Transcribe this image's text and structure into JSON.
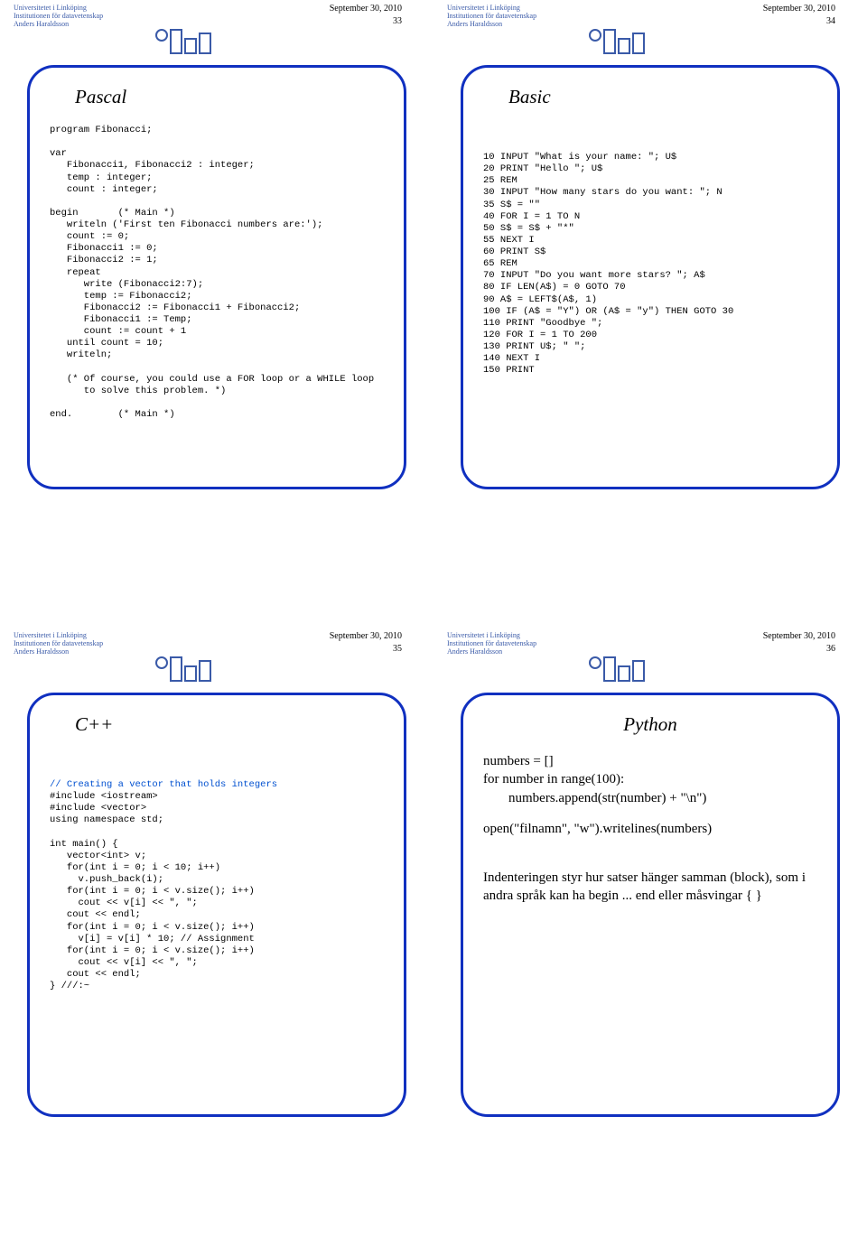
{
  "header": {
    "org1": "Universitetet i Linköping",
    "org2": "Institutionen för datavetenskap",
    "author": "Anders Haraldsson",
    "date": "September 30, 2010"
  },
  "slides": [
    {
      "num": "33",
      "title": "Pascal",
      "code": "program Fibonacci;\n\nvar\n   Fibonacci1, Fibonacci2 : integer;\n   temp : integer;\n   count : integer;\n\nbegin       (* Main *)\n   writeln ('First ten Fibonacci numbers are:');\n   count := 0;\n   Fibonacci1 := 0;\n   Fibonacci2 := 1;\n   repeat\n      write (Fibonacci2:7);\n      temp := Fibonacci2;\n      Fibonacci2 := Fibonacci1 + Fibonacci2;\n      Fibonacci1 := Temp;\n      count := count + 1\n   until count = 10;\n   writeln;\n\n   (* Of course, you could use a FOR loop or a WHILE loop\n      to solve this problem. *)\n\nend.        (* Main *)"
    },
    {
      "num": "34",
      "title": "Basic",
      "code": "10 INPUT \"What is your name: \"; U$\n20 PRINT \"Hello \"; U$\n25 REM\n30 INPUT \"How many stars do you want: \"; N\n35 S$ = \"\"\n40 FOR I = 1 TO N\n50 S$ = S$ + \"*\"\n55 NEXT I\n60 PRINT S$\n65 REM\n70 INPUT \"Do you want more stars? \"; A$\n80 IF LEN(A$) = 0 GOTO 70\n90 A$ = LEFT$(A$, 1)\n100 IF (A$ = \"Y\") OR (A$ = \"y\") THEN GOTO 30\n110 PRINT \"Goodbye \";\n120 FOR I = 1 TO 200\n130 PRINT U$; \" \";\n140 NEXT I\n150 PRINT"
    },
    {
      "num": "35",
      "title": "C++",
      "code_comment": "// Creating a vector that holds integers",
      "code": "#include <iostream>\n#include <vector>\nusing namespace std;\n\nint main() {\n   vector<int> v;\n   for(int i = 0; i < 10; i++)\n     v.push_back(i);\n   for(int i = 0; i < v.size(); i++)\n     cout << v[i] << \", \";\n   cout << endl;\n   for(int i = 0; i < v.size(); i++)\n     v[i] = v[i] * 10; // Assignment\n   for(int i = 0; i < v.size(); i++)\n     cout << v[i] << \", \";\n   cout << endl;\n} ///:~"
    },
    {
      "num": "36",
      "title": "Python",
      "py_l1": "numbers = []",
      "py_l2": "for number in range(100):",
      "py_l3": "numbers.append(str(number) + \"\\n\")",
      "py_l4": "open(\"filnamn\", \"w\").writelines(numbers)",
      "py_p2": "Indenteringen styr hur satser hänger samman (block), som i andra språk kan ha begin ... end eller måsvingar { }"
    }
  ]
}
